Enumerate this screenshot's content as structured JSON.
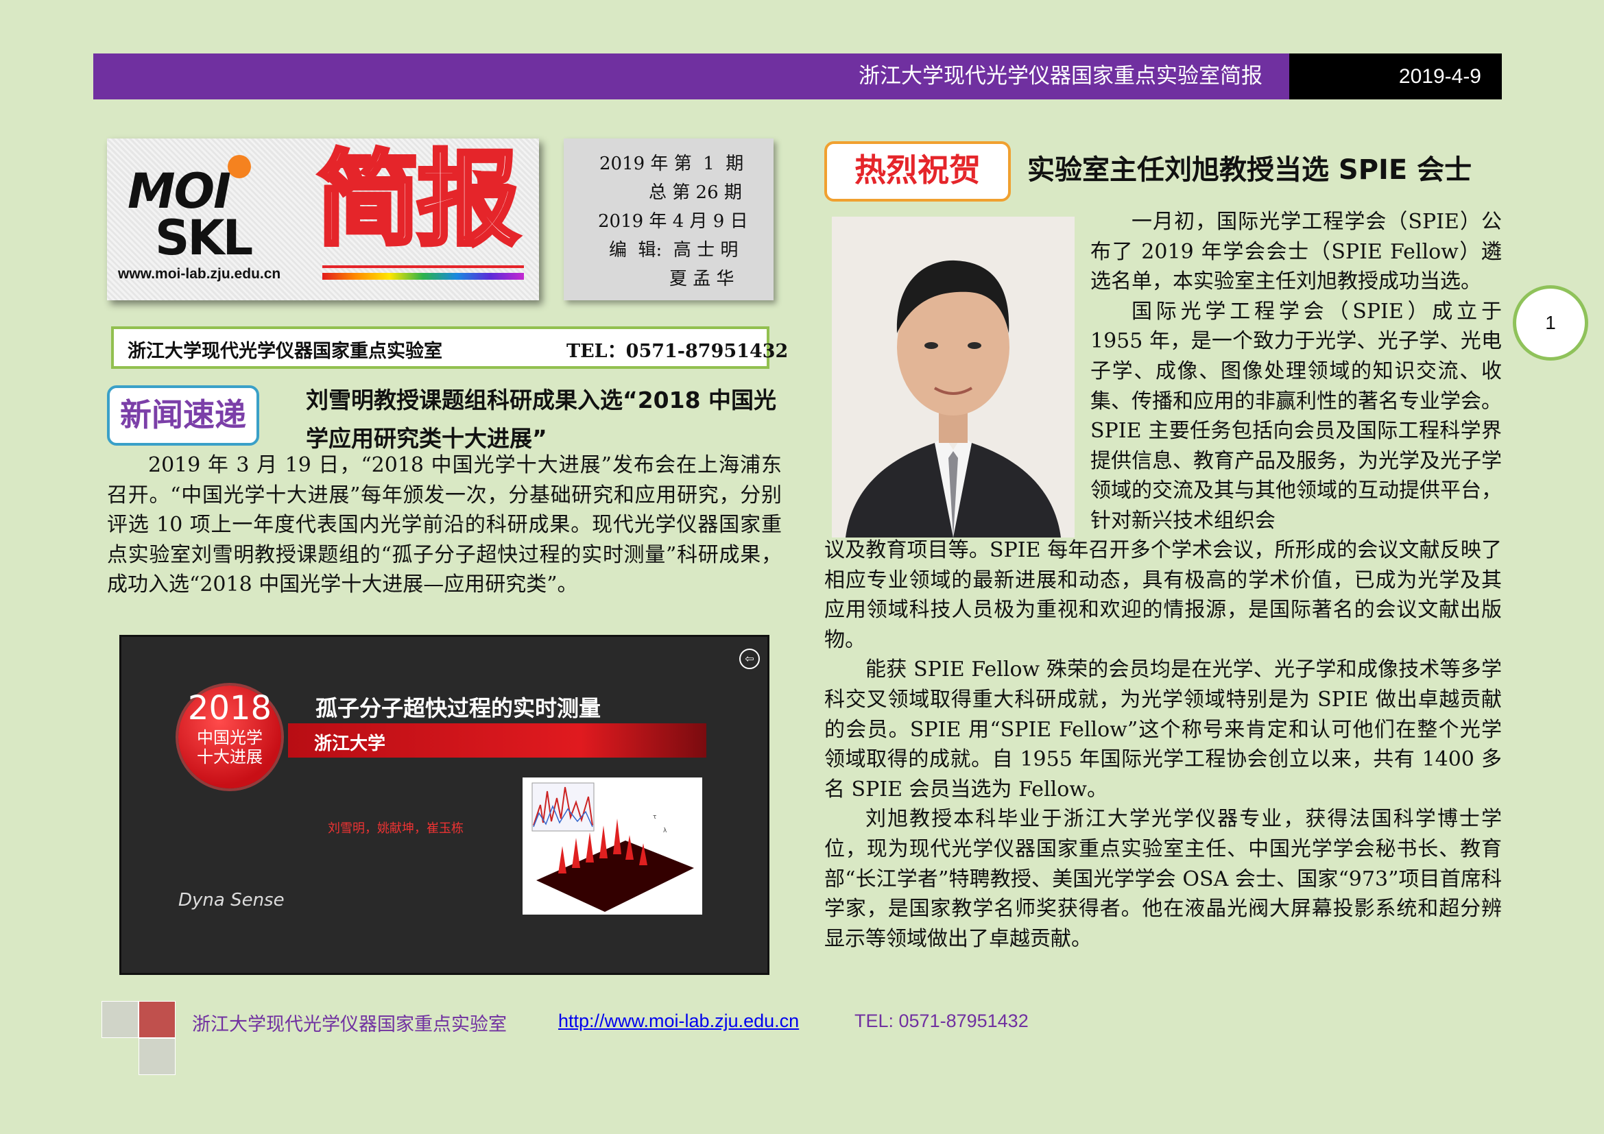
{
  "header": {
    "title": "浙江大学现代光学仪器国家重点实验室简报",
    "date": "2019-4-9"
  },
  "logo": {
    "moi": "MOI",
    "skl": "SKL",
    "url": "www.moi-lab.zju.edu.cn",
    "title": "简报"
  },
  "issue": {
    "line1": "2019 年 第  1  期",
    "line2": "总 第 26 期",
    "line3": "2019 年 4 月 9 日",
    "line4": "编  辑:  高 士 明",
    "line5": "夏 孟 华"
  },
  "lab": {
    "name": "浙江大学现代光学仪器国家重点实验室",
    "tel": "TEL：0571-87951432"
  },
  "news": {
    "badge": "新闻速递",
    "title": "刘雪明教授课题组科研成果入选“2018 中国光学应用研究类十大进展”",
    "body": "2019 年 3 月 19 日，“2018 中国光学十大进展”发布会在上海浦东召开。“中国光学十大进展”每年颁发一次，分基础研究和应用研究，分别评选 10 项上一年度代表国内光学前沿的科研成果。现代光学仪器国家重点实验室刘雪明教授课题组的“孤子分子超快过程的实时测量”科研成果，成功入选“2018 中国光学十大进展—应用研究类”。",
    "image": {
      "title": "孤子分子超快过程的实时测量",
      "university": "浙江大学",
      "badge_year": "2018",
      "badge_line1": "中国光学",
      "badge_line2": "十大进展",
      "authors": "刘雪明，姚献坤，崔玉栋",
      "brand": "Dyna Sense"
    }
  },
  "feature": {
    "badge": "热烈祝贺",
    "title": "实验室主任刘旭教授当选 SPIE 会士",
    "para1": "一月初，国际光学工程学会（SPIE）公布了 2019 年学会会士（SPIE Fellow）遴选名单，本实验室主任刘旭教授成功当选。",
    "para2_top": "国际光学工程学会（SPIE）成立于 1955 年，是一个致力于光学、光子学、光电子学、成像、图像处理领域的知识交流、收集、传播和应用的非赢利性的著名专业学会。SPIE 主要任务包括向会员及国际工程科学界提供信息、教育产品及服务，为光学及光子学领域的交流及其与其他领域的互动提供平台，针对新兴技术组织会",
    "para2_bottom": "议及教育项目等。SPIE 每年召开多个学术会议，所形成的会议文献反映了相应专业领域的最新进展和动态，具有极高的学术价值，已成为光学及其应用领域科技人员极为重视和欢迎的情报源，是国际著名的会议文献出版物。",
    "para3": "能获 SPIE Fellow 殊荣的会员均是在光学、光子学和成像技术等多学科交叉领域取得重大科研成就，为光学领域特别是为 SPIE 做出卓越贡献的会员。SPIE 用“SPIE Fellow”这个称号来肯定和认可他们在整个光学领域取得的成就。自 1955 年国际光学工程协会创立以来，共有 1400 多名 SPIE 会员当选为 Fellow。",
    "para4": "刘旭教授本科毕业于浙江大学光学仪器专业，获得法国科学博士学位，现为现代光学仪器国家重点实验室主任、中国光学学会秘书长、教育部“长江学者”特聘教授、美国光学学会 OSA 会士、国家“973”项目首席科学家，是国家教学名师奖获得者。他在液晶光阀大屏幕投影系统和超分辨显示等领域做出了卓越贡献。"
  },
  "page_number": "1",
  "footer": {
    "name": "浙江大学现代光学仪器国家重点实验室",
    "url": "http://www.moi-lab.zju.edu.cn",
    "tel": "TEL: 0571-87951432"
  },
  "colors": {
    "background": "#d9e8c4",
    "header_purple": "#7030a0",
    "accent_red": "#e5252a",
    "accent_green": "#92c050"
  }
}
